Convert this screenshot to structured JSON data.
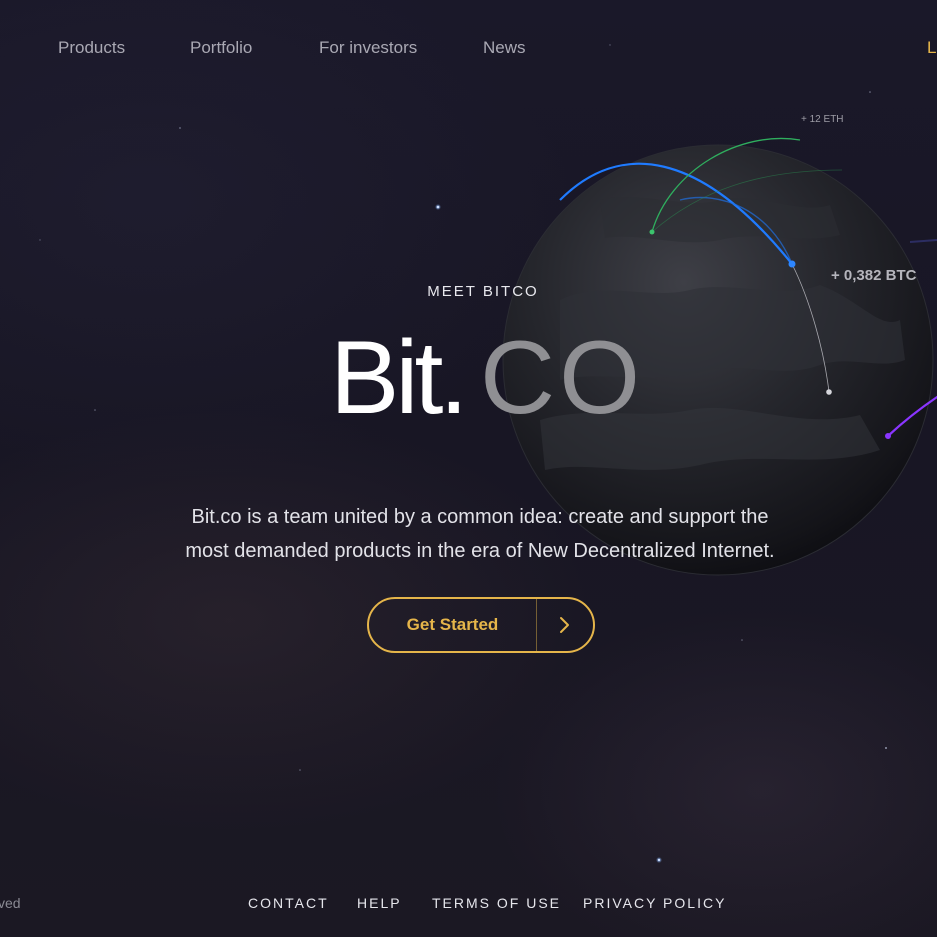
{
  "nav": {
    "items": [
      "Products",
      "Portfolio",
      "For investors",
      "News"
    ],
    "cut_item": "L"
  },
  "hero": {
    "eyebrow": "MEET BITCO",
    "logo_main": "Bit.",
    "logo_suffix": "CO",
    "tagline_line1": "Bit.co is a team united by a common idea: create and support the",
    "tagline_line2": "most demanded products in the era of New Decentralized Internet.",
    "cta_label": "Get Started"
  },
  "globe": {
    "btc_label": "+ 0,382 BTC",
    "eth_label": "+ 12 ETH"
  },
  "footer": {
    "cut_text": "ved",
    "links": [
      "CONTACT",
      "HELP",
      "TERMS OF USE",
      "PRIVACY POLICY"
    ]
  },
  "colors": {
    "accent": "#e5b54a",
    "background": "#1a1829",
    "nav_text": "#a9a8b3",
    "arc_blue": "#1f7bff",
    "arc_green": "#2fae5e",
    "arc_purple": "#8a35ff"
  },
  "icons": {
    "cta": "chevron-right-icon"
  }
}
